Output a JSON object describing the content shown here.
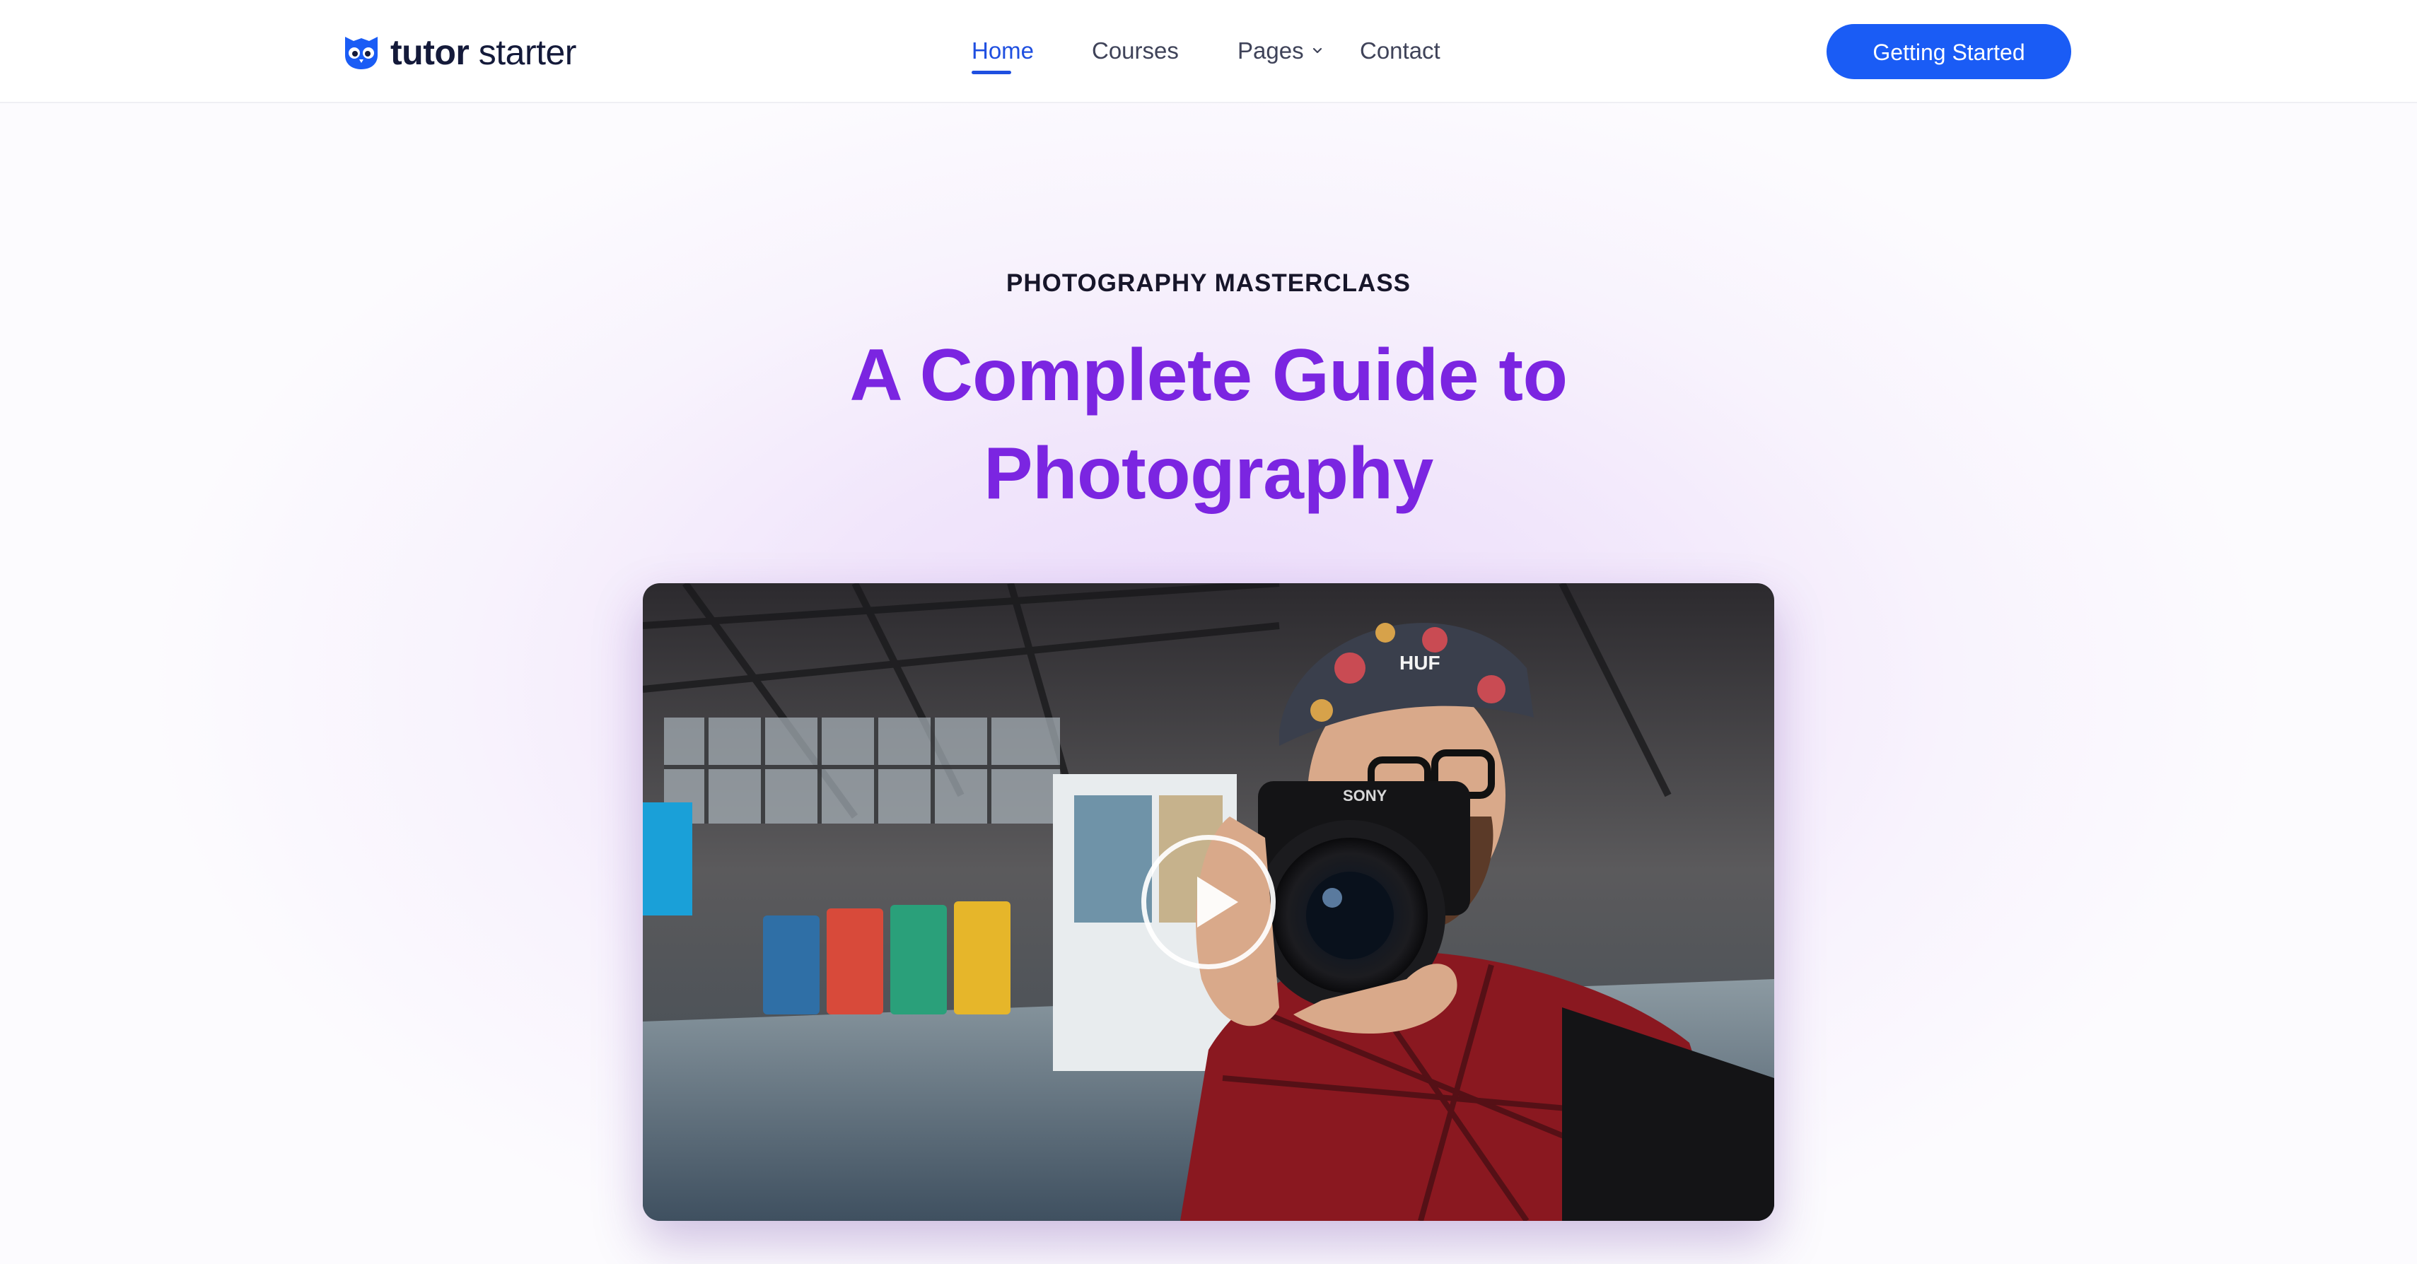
{
  "header": {
    "logo": {
      "bold": "tutor",
      "light": "starter",
      "icon": "owl-logo-icon"
    },
    "nav": [
      {
        "label": "Home",
        "active": true
      },
      {
        "label": "Courses",
        "active": false
      },
      {
        "label": "Pages",
        "active": false,
        "dropdown": true
      },
      {
        "label": "Contact",
        "active": false
      }
    ],
    "cta_label": "Getting Started"
  },
  "hero": {
    "eyebrow": "PHOTOGRAPHY MASTERCLASS",
    "title_line1": "A Complete Guide to",
    "title_line2": "Photography",
    "video": {
      "icon": "play-icon",
      "thumbnail_text": "SONY",
      "cap_text": "HUF"
    }
  },
  "colors": {
    "accent_blue": "#1a5cf5",
    "headline_purple": "#7b25e1",
    "nav_active": "#1f4fe0"
  }
}
